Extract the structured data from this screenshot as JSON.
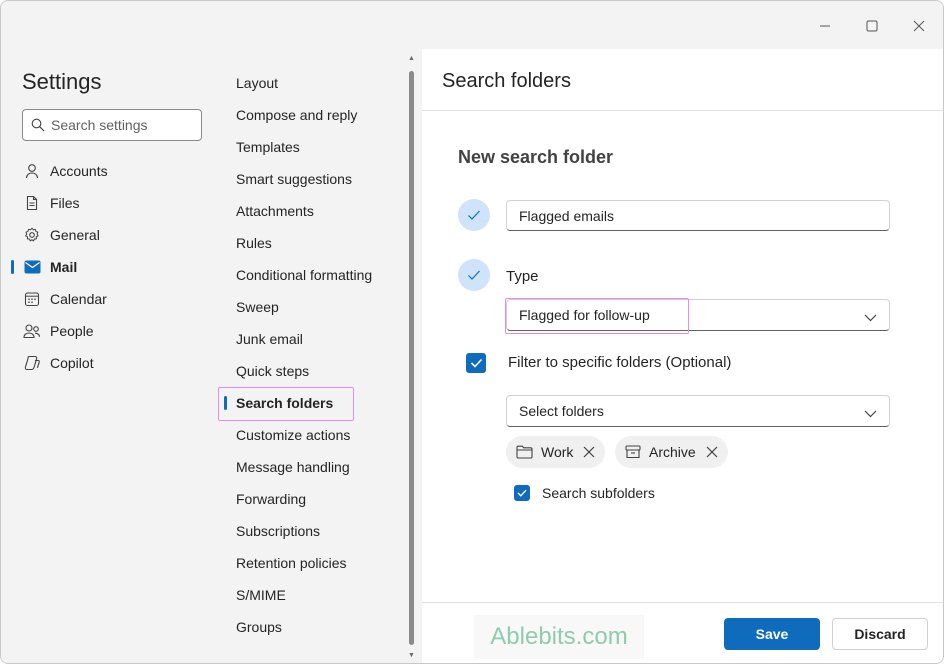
{
  "settings": {
    "title": "Settings",
    "search_placeholder": "Search settings"
  },
  "nav": {
    "items": [
      {
        "label": "Accounts",
        "icon": "person-icon"
      },
      {
        "label": "Files",
        "icon": "file-icon"
      },
      {
        "label": "General",
        "icon": "gear-icon"
      },
      {
        "label": "Mail",
        "icon": "mail-icon",
        "active": true
      },
      {
        "label": "Calendar",
        "icon": "calendar-icon"
      },
      {
        "label": "People",
        "icon": "people-icon"
      },
      {
        "label": "Copilot",
        "icon": "copilot-icon"
      }
    ]
  },
  "subnav": {
    "items": [
      "Layout",
      "Compose and reply",
      "Templates",
      "Smart suggestions",
      "Attachments",
      "Rules",
      "Conditional formatting",
      "Sweep",
      "Junk email",
      "Quick steps",
      "Search folders",
      "Customize actions",
      "Message handling",
      "Forwarding",
      "Subscriptions",
      "Retention policies",
      "S/MIME",
      "Groups"
    ],
    "active_index": 10
  },
  "main": {
    "title": "Search folders",
    "section_title": "New search folder",
    "name_value": "Flagged emails",
    "type_label": "Type",
    "type_value": "Flagged for follow-up",
    "filter_label": "Filter to specific folders (Optional)",
    "folders_placeholder": "Select folders",
    "chips": [
      {
        "label": "Work",
        "icon": "folder-icon"
      },
      {
        "label": "Archive",
        "icon": "archive-icon"
      }
    ],
    "subfolders_label": "Search subfolders"
  },
  "footer": {
    "watermark": "Ablebits.com",
    "save_label": "Save",
    "discard_label": "Discard"
  },
  "colors": {
    "accent": "#0f6cbd",
    "highlight": "#e68be6",
    "check_circle": "#cfe4fa"
  }
}
